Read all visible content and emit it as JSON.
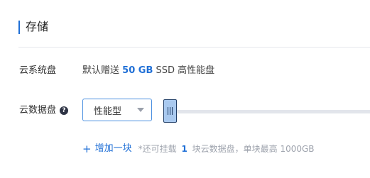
{
  "section": {
    "title": "存储"
  },
  "system_disk": {
    "label": "云系统盘",
    "prefix": "默认赠送",
    "size": "50 GB",
    "suffix": "SSD 高性能盘"
  },
  "data_disk": {
    "label": "云数据盘",
    "help_icon": "?",
    "type_select": {
      "value": "性能型"
    },
    "slider": {
      "level": 0
    },
    "add_link": {
      "icon": "+",
      "label": "增加一块"
    },
    "hint": {
      "before": "*还可挂载",
      "count": "1",
      "after": "块云数据盘，单块最高 1000GB"
    }
  },
  "colors": {
    "accent": "#1f6fd6",
    "track": "#e2e5eb",
    "handle": "#a9c9ef",
    "hint": "#9ea3ad"
  }
}
